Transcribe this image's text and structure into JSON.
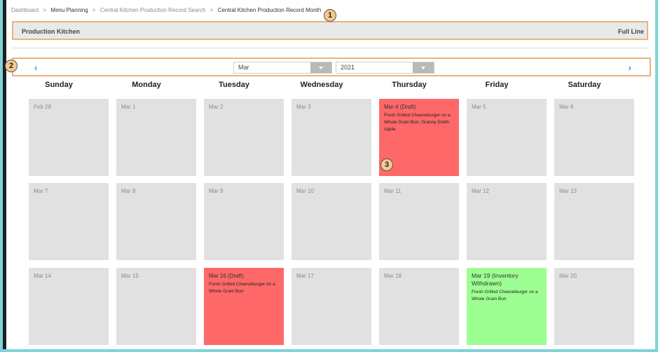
{
  "breadcrumb": [
    "Dashboard",
    "Menu Planning",
    "Central Kitchen Production Record Search",
    "Central Kitchen Production Record Month"
  ],
  "header": {
    "left": "Production Kitchen",
    "right": "Full Line"
  },
  "nav": {
    "prev": "‹",
    "next": "›",
    "month": "Mar",
    "year": "2021"
  },
  "days": [
    "Sunday",
    "Monday",
    "Tuesday",
    "Wednesday",
    "Thursday",
    "Friday",
    "Saturday"
  ],
  "weeks": [
    [
      {
        "date": "Feb 28",
        "menu": "",
        "status": "none"
      },
      {
        "date": "Mar 1",
        "menu": "",
        "status": "none"
      },
      {
        "date": "Mar 2",
        "menu": "",
        "status": "none"
      },
      {
        "date": "Mar 3",
        "menu": "",
        "status": "none"
      },
      {
        "date": "Mar 4 (Draft)",
        "menu": "Fresh Grilled Cheeseburger on a Whole Grain Bun, Granny Smith Apple",
        "status": "draft"
      },
      {
        "date": "Mar 5",
        "menu": "",
        "status": "none"
      },
      {
        "date": "Mar 6",
        "menu": "",
        "status": "none"
      }
    ],
    [
      {
        "date": "Mar 7",
        "menu": "",
        "status": "none"
      },
      {
        "date": "Mar 8",
        "menu": "",
        "status": "none"
      },
      {
        "date": "Mar 9",
        "menu": "",
        "status": "none"
      },
      {
        "date": "Mar 10",
        "menu": "",
        "status": "none"
      },
      {
        "date": "Mar 11",
        "menu": "",
        "status": "none"
      },
      {
        "date": "Mar 12",
        "menu": "",
        "status": "none"
      },
      {
        "date": "Mar 13",
        "menu": "",
        "status": "none"
      }
    ],
    [
      {
        "date": "Mar 14",
        "menu": "",
        "status": "none"
      },
      {
        "date": "Mar 15",
        "menu": "",
        "status": "none"
      },
      {
        "date": "Mar 16 (Draft)",
        "menu": "Fresh Grilled Cheeseburger on a Whole Grain Bun",
        "status": "draft"
      },
      {
        "date": "Mar 17",
        "menu": "",
        "status": "none"
      },
      {
        "date": "Mar 18",
        "menu": "",
        "status": "none"
      },
      {
        "date": "Mar 19 (Inventory Withdrawn)",
        "menu": "Fresh Grilled Cheeseburger on a Whole Grain Bun",
        "status": "withdrawn"
      },
      {
        "date": "Mar 20",
        "menu": "",
        "status": "none"
      }
    ]
  ],
  "callouts": [
    "1",
    "2",
    "3"
  ],
  "colors": {
    "draft": "#fe6868",
    "withdrawn": "#9dff91",
    "empty": "#e1e1e1",
    "highlight": "#e7b57a",
    "link": "#2a9bd6"
  }
}
